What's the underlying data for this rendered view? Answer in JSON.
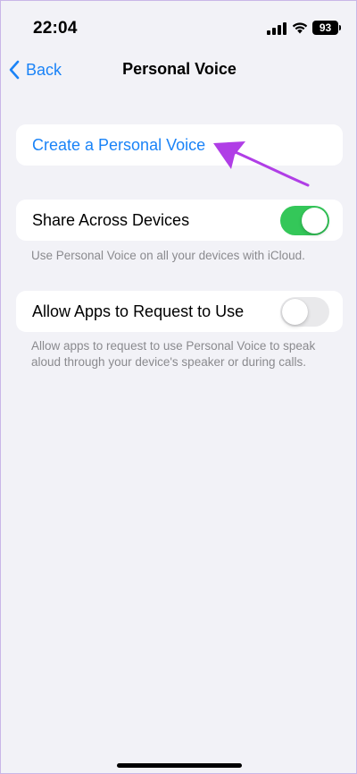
{
  "status_bar": {
    "time": "22:04",
    "battery_level": "93",
    "icons": [
      "signal-icon",
      "wifi-icon",
      "battery-icon"
    ]
  },
  "nav": {
    "back_label": "Back",
    "title": "Personal Voice"
  },
  "create": {
    "label": "Create a Personal Voice"
  },
  "share": {
    "label": "Share Across Devices",
    "enabled": true,
    "footer": "Use Personal Voice on all your devices with iCloud."
  },
  "allow": {
    "label": "Allow Apps to Request to Use",
    "enabled": false,
    "footer": "Allow apps to request to use Personal Voice to speak aloud through your device's speaker or during calls."
  },
  "colors": {
    "accent": "#1a83f7",
    "toggle_on": "#34c759",
    "toggle_off": "#e9e9eb",
    "annotation": "#b03ee6",
    "background": "#f2f2f7"
  }
}
